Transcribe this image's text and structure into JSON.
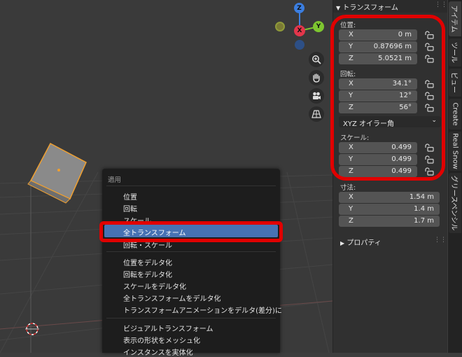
{
  "gizmo": {
    "z": "Z",
    "x": "X",
    "y": "Y"
  },
  "npanel": {
    "section_title": "トランスフォーム",
    "location": {
      "label": "位置:",
      "fields": [
        {
          "axis": "X",
          "value": "0 m"
        },
        {
          "axis": "Y",
          "value": "0.87696 m"
        },
        {
          "axis": "Z",
          "value": "5.0521 m"
        }
      ]
    },
    "rotation": {
      "label": "回転:",
      "fields": [
        {
          "axis": "X",
          "value": "34.1°"
        },
        {
          "axis": "Y",
          "value": "12°"
        },
        {
          "axis": "Z",
          "value": "56°"
        }
      ],
      "mode": "XYZ オイラー角"
    },
    "scale": {
      "label": "スケール:",
      "fields": [
        {
          "axis": "X",
          "value": "0.499"
        },
        {
          "axis": "Y",
          "value": "0.499"
        },
        {
          "axis": "Z",
          "value": "0.499"
        }
      ]
    },
    "dimensions": {
      "label": "寸法:",
      "fields": [
        {
          "axis": "X",
          "value": "1.54 m"
        },
        {
          "axis": "Y",
          "value": "1.4 m"
        },
        {
          "axis": "Z",
          "value": "1.7 m"
        }
      ]
    },
    "properties": "プロパティ"
  },
  "tabs": [
    "アイテム",
    "ツール",
    "ビュー",
    "Create",
    "Real Snow",
    "グリースペンシル"
  ],
  "menu": {
    "title": "適用",
    "group1": [
      "位置",
      "回転",
      "スケール",
      "全トランスフォーム",
      "回転・スケール"
    ],
    "group2": [
      "位置をデルタ化",
      "回転をデルタ化",
      "スケールをデルタ化",
      "全トランスフォームをデルタ化",
      "トランスフォームアニメーションをデルタ(差分)に"
    ],
    "group3": [
      "ビジュアルトランスフォーム",
      "表示の形状をメッシュ化",
      "インスタンスを実体化"
    ]
  },
  "colors": {
    "highlight": "#4772b3",
    "annotation": "#e10000",
    "x_axis": "#e3364b",
    "y_axis": "#7ec630",
    "z_axis": "#3b7ee0"
  }
}
